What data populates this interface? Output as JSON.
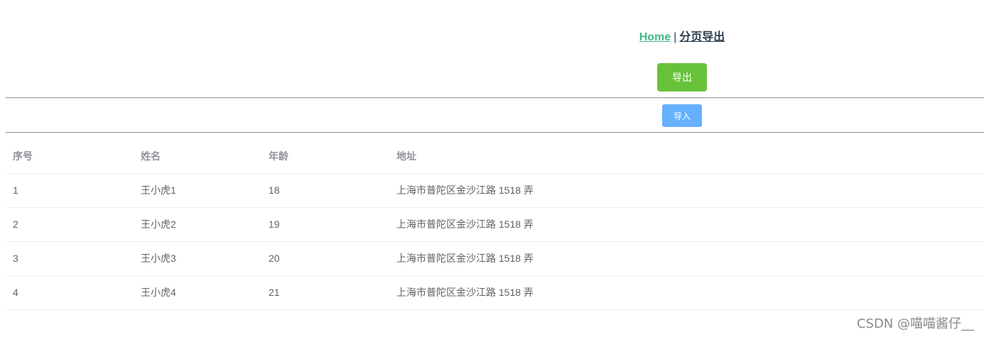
{
  "nav": {
    "home_label": "Home",
    "separator": "|",
    "current_label": "分页导出"
  },
  "actions": {
    "export_label": "导出",
    "import_label": "导入"
  },
  "table": {
    "columns": [
      "序号",
      "姓名",
      "年龄",
      "地址"
    ],
    "rows": [
      [
        "1",
        "王小虎1",
        "18",
        "上海市普陀区金沙江路 1518 弄"
      ],
      [
        "2",
        "王小虎2",
        "19",
        "上海市普陀区金沙江路 1518 弄"
      ],
      [
        "3",
        "王小虎3",
        "20",
        "上海市普陀区金沙江路 1518 弄"
      ],
      [
        "4",
        "王小虎4",
        "21",
        "上海市普陀区金沙江路 1518 弄"
      ]
    ]
  },
  "watermark": "CSDN @喵喵酱仔__",
  "colors": {
    "nav_link": "#42b983",
    "nav_text": "#2c3e50",
    "export_button": "#67c23a",
    "import_button": "#66b1ff"
  }
}
